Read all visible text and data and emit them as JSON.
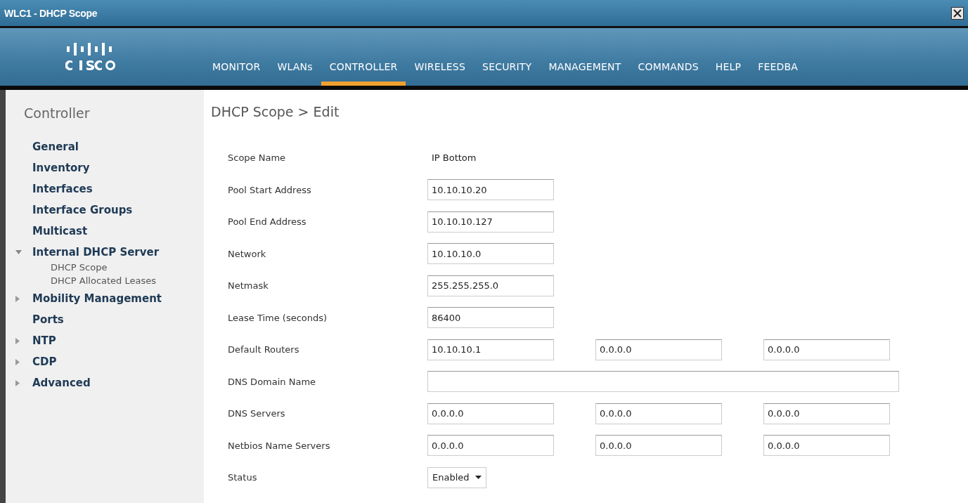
{
  "window": {
    "title": "WLC1 -  DHCP Scope"
  },
  "nav": [
    {
      "label": "MONITOR",
      "selected": false
    },
    {
      "label": "WLANs",
      "selected": false
    },
    {
      "label": "CONTROLLER",
      "selected": true
    },
    {
      "label": "WIRELESS",
      "selected": false
    },
    {
      "label": "SECURITY",
      "selected": false
    },
    {
      "label": "MANAGEMENT",
      "selected": false
    },
    {
      "label": "COMMANDS",
      "selected": false
    },
    {
      "label": "HELP",
      "selected": false
    },
    {
      "label": "FEEDBA",
      "selected": false
    }
  ],
  "sidebar": {
    "title": "Controller",
    "items": [
      {
        "label": "General",
        "kind": "link"
      },
      {
        "label": "Inventory",
        "kind": "link"
      },
      {
        "label": "Interfaces",
        "kind": "link"
      },
      {
        "label": "Interface Groups",
        "kind": "link"
      },
      {
        "label": "Multicast",
        "kind": "link"
      },
      {
        "label": "Internal DHCP Server",
        "kind": "folder",
        "expanded": true,
        "children": [
          {
            "label": "DHCP Scope"
          },
          {
            "label": "DHCP Allocated Leases"
          }
        ]
      },
      {
        "label": "Mobility Management",
        "kind": "folder",
        "expanded": false
      },
      {
        "label": "Ports",
        "kind": "link"
      },
      {
        "label": "NTP",
        "kind": "folder",
        "expanded": false
      },
      {
        "label": "CDP",
        "kind": "folder",
        "expanded": false
      },
      {
        "label": "Advanced",
        "kind": "folder",
        "expanded": false
      }
    ]
  },
  "page": {
    "title": "DHCP Scope > Edit",
    "rows": [
      {
        "label": "Scope Name",
        "kind": "text",
        "value": "IP Bottom"
      },
      {
        "label": "Pool Start Address",
        "kind": "fields",
        "values": [
          "10.10.10.20"
        ]
      },
      {
        "label": "Pool End Address",
        "kind": "fields",
        "values": [
          "10.10.10.127"
        ]
      },
      {
        "label": "Network",
        "kind": "fields",
        "values": [
          "10.10.10.0"
        ]
      },
      {
        "label": "Netmask",
        "kind": "fields",
        "values": [
          "255.255.255.0"
        ]
      },
      {
        "label": "Lease Time (seconds)",
        "kind": "fields",
        "values": [
          "86400"
        ]
      },
      {
        "label": "Default Routers",
        "kind": "fields",
        "values": [
          "10.10.10.1",
          "0.0.0.0",
          "0.0.0.0"
        ]
      },
      {
        "label": "DNS Domain Name",
        "kind": "wide"
      },
      {
        "label": "DNS Servers",
        "kind": "fields",
        "values": [
          "0.0.0.0",
          "0.0.0.0",
          "0.0.0.0"
        ]
      },
      {
        "label": "Netbios Name Servers",
        "kind": "fields",
        "values": [
          "0.0.0.0",
          "0.0.0.0",
          "0.0.0.0"
        ]
      },
      {
        "label": "Status",
        "kind": "select",
        "value": "Enabled"
      }
    ]
  }
}
